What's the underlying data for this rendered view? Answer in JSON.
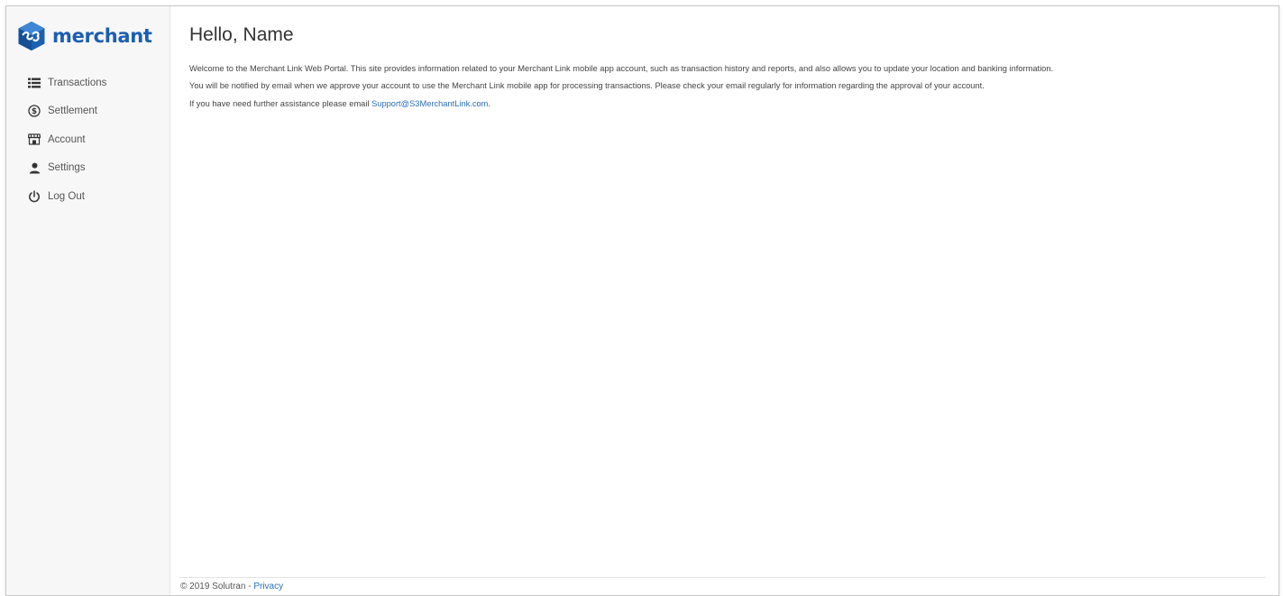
{
  "brand": {
    "name": "merchant",
    "color": "#1b5fb0"
  },
  "sidebar": {
    "items": [
      {
        "label": "Transactions",
        "icon": "list-icon"
      },
      {
        "label": "Settlement",
        "icon": "dollar-circle-icon"
      },
      {
        "label": "Account",
        "icon": "store-icon"
      },
      {
        "label": "Settings",
        "icon": "user-icon"
      },
      {
        "label": "Log Out",
        "icon": "power-icon"
      }
    ]
  },
  "main": {
    "title": "Hello, Name",
    "paragraphs": [
      "Welcome to the Merchant Link Web Portal. This site provides information related to your Merchant Link mobile app account, such as transaction history and reports, and also allows you to update your location and banking information.",
      "You will be notified by email when we approve your account to use the Merchant Link mobile app for processing transactions. Please check your email regularly for information regarding the approval of your account."
    ],
    "assistance_text": "If you have need further assistance please email ",
    "support_email": "Support@S3MerchantLink.com",
    "assistance_end": "."
  },
  "footer": {
    "copyright": "© 2019 Solutran - ",
    "privacy_label": "Privacy"
  },
  "colors": {
    "link": "#2a6ebd",
    "sidebar_bg": "#f7f7f7"
  }
}
